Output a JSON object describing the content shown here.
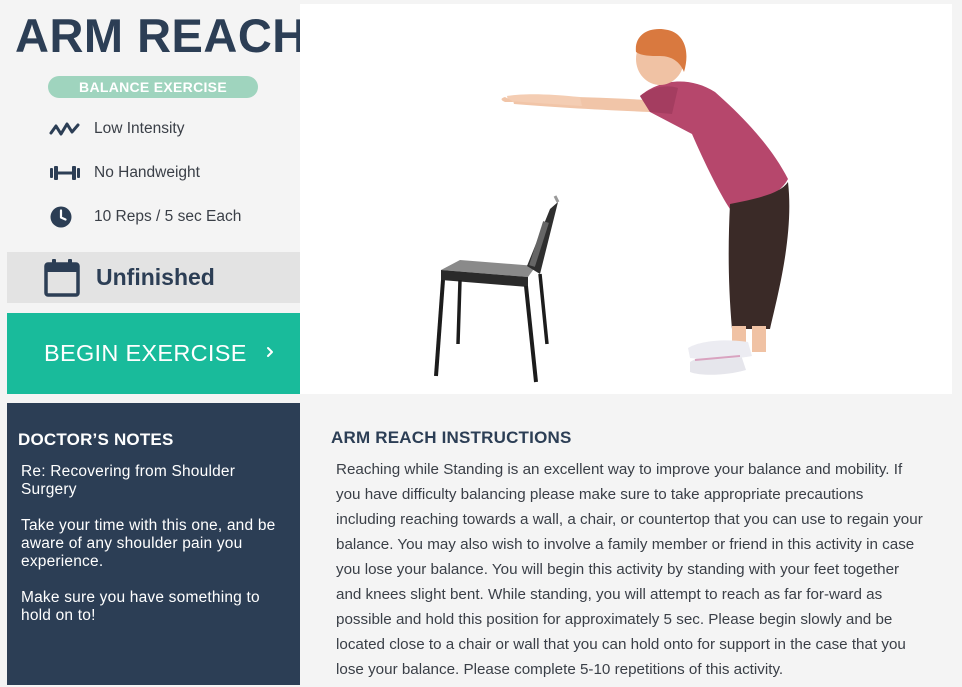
{
  "exercise": {
    "title": "ARM REACH",
    "category": "BALANCE EXERCISE",
    "intensity": "Low Intensity",
    "equipment": "No Handweight",
    "reps": "10 Reps / 5 sec Each",
    "status": "Unfinished"
  },
  "actions": {
    "begin_label": "BEGIN EXERCISE"
  },
  "notes": {
    "title": "DOCTOR’S NOTES",
    "items": [
      "Re: Recovering from Shoulder Surgery",
      "Take your time with this one, and be aware of any shoulder pain you experience.",
      "Make sure you have something to hold on to!"
    ]
  },
  "instructions": {
    "title": "ARM REACH INSTRUCTIONS",
    "body": "Reaching while Standing is an excellent way to improve your balance and mobility. If you have difficulty balancing please make sure to take appropriate precautions including reaching towards a wall, a chair, or countertop that you can use to regain your balance. You may also wish to involve a family member or friend in this activity in case you lose your balance. You will begin this activity by standing with your feet together and knees slight bent. While standing, you will attempt to reach as far for-ward as possible and hold this position for approximately 5 sec. Please begin slowly and be located close to a chair or wall that you can hold onto for support in the case that you lose your balance. Please complete 5-10 repetitions of this activity."
  },
  "icons": {
    "intensity": "wave-icon",
    "equipment": "dumbbell-icon",
    "reps": "clock-icon",
    "status": "calendar-icon",
    "begin": "chevron-right-icon"
  },
  "colors": {
    "navy": "#2c3e55",
    "teal": "#19bb9b",
    "badge": "#9fd4be",
    "panel": "#f4f4f4",
    "status_bg": "#e3e3e3"
  }
}
